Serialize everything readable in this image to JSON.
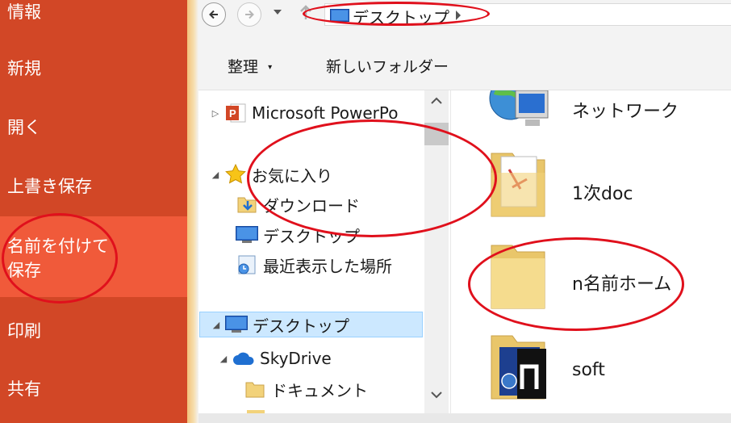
{
  "backstage": {
    "items": [
      {
        "label": "情報"
      },
      {
        "label": "新規"
      },
      {
        "label": "開く"
      },
      {
        "label": "上書き保存"
      },
      {
        "label": "名前を付けて\n保存",
        "active": true
      },
      {
        "label": "印刷"
      },
      {
        "label": "共有"
      }
    ]
  },
  "addressbar": {
    "location": "デスクトップ"
  },
  "toolbar": {
    "organize_label": "整理",
    "new_folder_label": "新しいフォルダー"
  },
  "navtree": {
    "items": [
      {
        "label": "Microsoft PowerPo",
        "icon": "powerpoint-icon"
      },
      {
        "label": "お気に入り",
        "icon": "star-icon"
      },
      {
        "label": "ダウンロード",
        "icon": "download-folder-icon"
      },
      {
        "label": "デスクトップ",
        "icon": "desktop-icon"
      },
      {
        "label": "最近表示した場所",
        "icon": "recent-places-icon"
      },
      {
        "label": "デスクトップ",
        "icon": "desktop-icon",
        "selected": true
      },
      {
        "label": "SkyDrive",
        "icon": "skydrive-icon"
      },
      {
        "label": "ドキュメント",
        "icon": "folder-icon"
      }
    ]
  },
  "content": {
    "items": [
      {
        "label": "ネットワーク",
        "icon": "network-icon"
      },
      {
        "label": "1次doc",
        "icon": "document-folder-icon"
      },
      {
        "label": "n名前ホーム",
        "icon": "folder-icon"
      },
      {
        "label": "soft",
        "icon": "software-folder-icon"
      }
    ]
  },
  "colors": {
    "backstage_bg": "#d24726",
    "backstage_active": "#f05a3a",
    "selection": "#cce8ff",
    "annotation": "#e0101c"
  }
}
